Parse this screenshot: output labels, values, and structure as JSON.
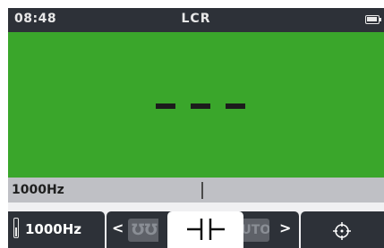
{
  "status_bar": {
    "time": "08:48",
    "mode_title": "LCR",
    "battery_icon": "battery-icon"
  },
  "reading": {
    "value": "- - -",
    "background_color": "#3aa62b"
  },
  "info_bar": {
    "frequency": "1000Hz"
  },
  "soft_keys": {
    "frequency_key": {
      "label": "1000Hz",
      "icon": "level-bar-icon"
    },
    "component_selector": {
      "prev_icon": "chevron-left-icon",
      "next_icon": "chevron-right-icon",
      "options": [
        {
          "label": "inductor",
          "icon": "inductor-icon",
          "selected": false
        },
        {
          "label": "capacitor",
          "icon": "capacitor-icon",
          "selected": true
        },
        {
          "label": "AUTO",
          "selected": false
        }
      ]
    },
    "target_key": {
      "icon": "crosshair-icon"
    }
  },
  "colors": {
    "status_bar": "#2d3138",
    "reading_area": "#3aa62b",
    "info_bar": "#bfc0c5",
    "soft_key": "#2d3138"
  }
}
